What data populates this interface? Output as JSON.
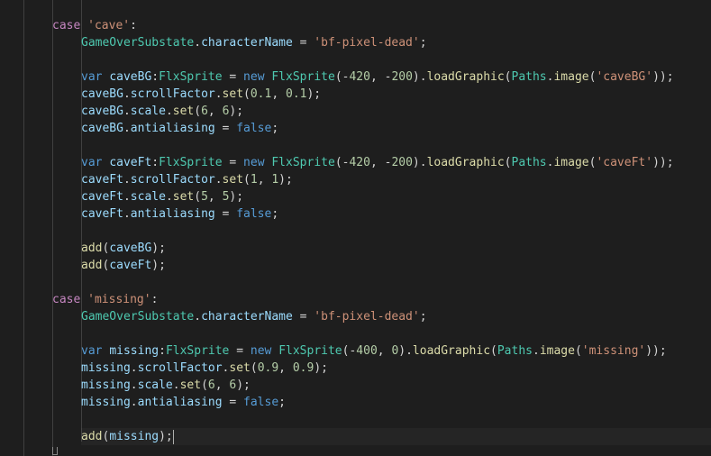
{
  "colors": {
    "background": "#1e1e1e",
    "keyword": "#569cd6",
    "control": "#c586c0",
    "class": "#4ec9b0",
    "property": "#9cdcfe",
    "func": "#dcdcaa",
    "string": "#ce9178",
    "number": "#b5cea8",
    "plain": "#d4d4d4"
  },
  "editor": {
    "lines": [
      {
        "indent": 1,
        "tokens": [
          {
            "t": "case",
            "c": "control"
          },
          {
            "t": " ",
            "c": "plain"
          },
          {
            "t": "'cave'",
            "c": "string"
          },
          {
            "t": ":",
            "c": "plain"
          }
        ]
      },
      {
        "indent": 2,
        "tokens": [
          {
            "t": "GameOverSubstate",
            "c": "class"
          },
          {
            "t": ".",
            "c": "plain"
          },
          {
            "t": "characterName",
            "c": "property"
          },
          {
            "t": " = ",
            "c": "plain"
          },
          {
            "t": "'bf-pixel-dead'",
            "c": "string"
          },
          {
            "t": ";",
            "c": "plain"
          }
        ]
      },
      {
        "indent": 0,
        "tokens": []
      },
      {
        "indent": 2,
        "tokens": [
          {
            "t": "var",
            "c": "keyword"
          },
          {
            "t": " ",
            "c": "plain"
          },
          {
            "t": "caveBG",
            "c": "property"
          },
          {
            "t": ":",
            "c": "plain"
          },
          {
            "t": "FlxSprite",
            "c": "class"
          },
          {
            "t": " = ",
            "c": "plain"
          },
          {
            "t": "new",
            "c": "keyword"
          },
          {
            "t": " ",
            "c": "plain"
          },
          {
            "t": "FlxSprite",
            "c": "class"
          },
          {
            "t": "(-",
            "c": "plain"
          },
          {
            "t": "420",
            "c": "number"
          },
          {
            "t": ", -",
            "c": "plain"
          },
          {
            "t": "200",
            "c": "number"
          },
          {
            "t": ").",
            "c": "plain"
          },
          {
            "t": "loadGraphic",
            "c": "func"
          },
          {
            "t": "(",
            "c": "plain"
          },
          {
            "t": "Paths",
            "c": "class"
          },
          {
            "t": ".",
            "c": "plain"
          },
          {
            "t": "image",
            "c": "func"
          },
          {
            "t": "(",
            "c": "plain"
          },
          {
            "t": "'caveBG'",
            "c": "string"
          },
          {
            "t": "));",
            "c": "plain"
          }
        ]
      },
      {
        "indent": 2,
        "tokens": [
          {
            "t": "caveBG",
            "c": "property"
          },
          {
            "t": ".",
            "c": "plain"
          },
          {
            "t": "scrollFactor",
            "c": "property"
          },
          {
            "t": ".",
            "c": "plain"
          },
          {
            "t": "set",
            "c": "func"
          },
          {
            "t": "(",
            "c": "plain"
          },
          {
            "t": "0.1",
            "c": "number"
          },
          {
            "t": ", ",
            "c": "plain"
          },
          {
            "t": "0.1",
            "c": "number"
          },
          {
            "t": ");",
            "c": "plain"
          }
        ]
      },
      {
        "indent": 2,
        "tokens": [
          {
            "t": "caveBG",
            "c": "property"
          },
          {
            "t": ".",
            "c": "plain"
          },
          {
            "t": "scale",
            "c": "property"
          },
          {
            "t": ".",
            "c": "plain"
          },
          {
            "t": "set",
            "c": "func"
          },
          {
            "t": "(",
            "c": "plain"
          },
          {
            "t": "6",
            "c": "number"
          },
          {
            "t": ", ",
            "c": "plain"
          },
          {
            "t": "6",
            "c": "number"
          },
          {
            "t": ");",
            "c": "plain"
          }
        ]
      },
      {
        "indent": 2,
        "tokens": [
          {
            "t": "caveBG",
            "c": "property"
          },
          {
            "t": ".",
            "c": "plain"
          },
          {
            "t": "antialiasing",
            "c": "property"
          },
          {
            "t": " = ",
            "c": "plain"
          },
          {
            "t": "false",
            "c": "keyword"
          },
          {
            "t": ";",
            "c": "plain"
          }
        ]
      },
      {
        "indent": 0,
        "tokens": []
      },
      {
        "indent": 2,
        "tokens": [
          {
            "t": "var",
            "c": "keyword"
          },
          {
            "t": " ",
            "c": "plain"
          },
          {
            "t": "caveFt",
            "c": "property"
          },
          {
            "t": ":",
            "c": "plain"
          },
          {
            "t": "FlxSprite",
            "c": "class"
          },
          {
            "t": " = ",
            "c": "plain"
          },
          {
            "t": "new",
            "c": "keyword"
          },
          {
            "t": " ",
            "c": "plain"
          },
          {
            "t": "FlxSprite",
            "c": "class"
          },
          {
            "t": "(-",
            "c": "plain"
          },
          {
            "t": "420",
            "c": "number"
          },
          {
            "t": ", -",
            "c": "plain"
          },
          {
            "t": "200",
            "c": "number"
          },
          {
            "t": ").",
            "c": "plain"
          },
          {
            "t": "loadGraphic",
            "c": "func"
          },
          {
            "t": "(",
            "c": "plain"
          },
          {
            "t": "Paths",
            "c": "class"
          },
          {
            "t": ".",
            "c": "plain"
          },
          {
            "t": "image",
            "c": "func"
          },
          {
            "t": "(",
            "c": "plain"
          },
          {
            "t": "'caveFt'",
            "c": "string"
          },
          {
            "t": "));",
            "c": "plain"
          }
        ]
      },
      {
        "indent": 2,
        "tokens": [
          {
            "t": "caveFt",
            "c": "property"
          },
          {
            "t": ".",
            "c": "plain"
          },
          {
            "t": "scrollFactor",
            "c": "property"
          },
          {
            "t": ".",
            "c": "plain"
          },
          {
            "t": "set",
            "c": "func"
          },
          {
            "t": "(",
            "c": "plain"
          },
          {
            "t": "1",
            "c": "number"
          },
          {
            "t": ", ",
            "c": "plain"
          },
          {
            "t": "1",
            "c": "number"
          },
          {
            "t": ");",
            "c": "plain"
          }
        ]
      },
      {
        "indent": 2,
        "tokens": [
          {
            "t": "caveFt",
            "c": "property"
          },
          {
            "t": ".",
            "c": "plain"
          },
          {
            "t": "scale",
            "c": "property"
          },
          {
            "t": ".",
            "c": "plain"
          },
          {
            "t": "set",
            "c": "func"
          },
          {
            "t": "(",
            "c": "plain"
          },
          {
            "t": "5",
            "c": "number"
          },
          {
            "t": ", ",
            "c": "plain"
          },
          {
            "t": "5",
            "c": "number"
          },
          {
            "t": ");",
            "c": "plain"
          }
        ]
      },
      {
        "indent": 2,
        "tokens": [
          {
            "t": "caveFt",
            "c": "property"
          },
          {
            "t": ".",
            "c": "plain"
          },
          {
            "t": "antialiasing",
            "c": "property"
          },
          {
            "t": " = ",
            "c": "plain"
          },
          {
            "t": "false",
            "c": "keyword"
          },
          {
            "t": ";",
            "c": "plain"
          }
        ]
      },
      {
        "indent": 0,
        "tokens": []
      },
      {
        "indent": 2,
        "tokens": [
          {
            "t": "add",
            "c": "func"
          },
          {
            "t": "(",
            "c": "plain"
          },
          {
            "t": "caveBG",
            "c": "property"
          },
          {
            "t": ");",
            "c": "plain"
          }
        ]
      },
      {
        "indent": 2,
        "tokens": [
          {
            "t": "add",
            "c": "func"
          },
          {
            "t": "(",
            "c": "plain"
          },
          {
            "t": "caveFt",
            "c": "property"
          },
          {
            "t": ");",
            "c": "plain"
          }
        ]
      },
      {
        "indent": 0,
        "tokens": []
      },
      {
        "indent": 1,
        "tokens": [
          {
            "t": "case",
            "c": "control"
          },
          {
            "t": " ",
            "c": "plain"
          },
          {
            "t": "'missing'",
            "c": "string"
          },
          {
            "t": ":",
            "c": "plain"
          }
        ]
      },
      {
        "indent": 2,
        "tokens": [
          {
            "t": "GameOverSubstate",
            "c": "class"
          },
          {
            "t": ".",
            "c": "plain"
          },
          {
            "t": "characterName",
            "c": "property"
          },
          {
            "t": " = ",
            "c": "plain"
          },
          {
            "t": "'bf-pixel-dead'",
            "c": "string"
          },
          {
            "t": ";",
            "c": "plain"
          }
        ]
      },
      {
        "indent": 0,
        "tokens": []
      },
      {
        "indent": 2,
        "tokens": [
          {
            "t": "var",
            "c": "keyword"
          },
          {
            "t": " ",
            "c": "plain"
          },
          {
            "t": "missing",
            "c": "property"
          },
          {
            "t": ":",
            "c": "plain"
          },
          {
            "t": "FlxSprite",
            "c": "class"
          },
          {
            "t": " = ",
            "c": "plain"
          },
          {
            "t": "new",
            "c": "keyword"
          },
          {
            "t": " ",
            "c": "plain"
          },
          {
            "t": "FlxSprite",
            "c": "class"
          },
          {
            "t": "(-",
            "c": "plain"
          },
          {
            "t": "400",
            "c": "number"
          },
          {
            "t": ", ",
            "c": "plain"
          },
          {
            "t": "0",
            "c": "number"
          },
          {
            "t": ").",
            "c": "plain"
          },
          {
            "t": "loadGraphic",
            "c": "func"
          },
          {
            "t": "(",
            "c": "plain"
          },
          {
            "t": "Paths",
            "c": "class"
          },
          {
            "t": ".",
            "c": "plain"
          },
          {
            "t": "image",
            "c": "func"
          },
          {
            "t": "(",
            "c": "plain"
          },
          {
            "t": "'missing'",
            "c": "string"
          },
          {
            "t": "));",
            "c": "plain"
          }
        ]
      },
      {
        "indent": 2,
        "tokens": [
          {
            "t": "missing",
            "c": "property"
          },
          {
            "t": ".",
            "c": "plain"
          },
          {
            "t": "scrollFactor",
            "c": "property"
          },
          {
            "t": ".",
            "c": "plain"
          },
          {
            "t": "set",
            "c": "func"
          },
          {
            "t": "(",
            "c": "plain"
          },
          {
            "t": "0.9",
            "c": "number"
          },
          {
            "t": ", ",
            "c": "plain"
          },
          {
            "t": "0.9",
            "c": "number"
          },
          {
            "t": ");",
            "c": "plain"
          }
        ]
      },
      {
        "indent": 2,
        "tokens": [
          {
            "t": "missing",
            "c": "property"
          },
          {
            "t": ".",
            "c": "plain"
          },
          {
            "t": "scale",
            "c": "property"
          },
          {
            "t": ".",
            "c": "plain"
          },
          {
            "t": "set",
            "c": "func"
          },
          {
            "t": "(",
            "c": "plain"
          },
          {
            "t": "6",
            "c": "number"
          },
          {
            "t": ", ",
            "c": "plain"
          },
          {
            "t": "6",
            "c": "number"
          },
          {
            "t": ");",
            "c": "plain"
          }
        ]
      },
      {
        "indent": 2,
        "tokens": [
          {
            "t": "missing",
            "c": "property"
          },
          {
            "t": ".",
            "c": "plain"
          },
          {
            "t": "antialiasing",
            "c": "property"
          },
          {
            "t": " = ",
            "c": "plain"
          },
          {
            "t": "false",
            "c": "keyword"
          },
          {
            "t": ";",
            "c": "plain"
          }
        ]
      },
      {
        "indent": 0,
        "tokens": []
      },
      {
        "indent": 2,
        "cursor": true,
        "tokens": [
          {
            "t": "add",
            "c": "func"
          },
          {
            "t": "(",
            "c": "plain"
          },
          {
            "t": "missing",
            "c": "property"
          },
          {
            "t": ");",
            "c": "plain"
          }
        ]
      }
    ]
  }
}
